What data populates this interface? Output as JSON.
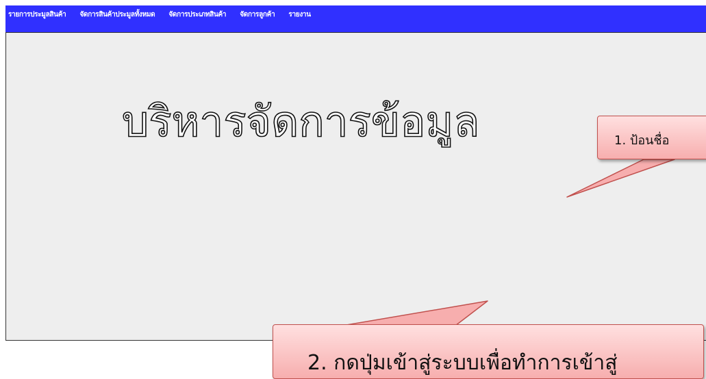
{
  "menu": {
    "items": [
      {
        "label": "รายการประมูลสินค้า"
      },
      {
        "label": "จัดการสินค้าประมูลทั้งหมด"
      },
      {
        "label": "จัดการประเภทสินค้า"
      },
      {
        "label": "จัดการลูกค้า"
      },
      {
        "label": "รายงาน"
      }
    ]
  },
  "main": {
    "title": "บริหารจัดการข้อมูล"
  },
  "callouts": {
    "step1": "1. ป้อนชื่อ",
    "step2": "2. กดปุ่มเข้าสู่ระบบเพื่อทำการเข้าสู่"
  },
  "colors": {
    "menubar_bg": "#3030ff",
    "menu_text": "#ffffff",
    "content_bg": "#eeeeee",
    "callout_fill": "#f7aeae",
    "callout_border": "#c0504d"
  }
}
